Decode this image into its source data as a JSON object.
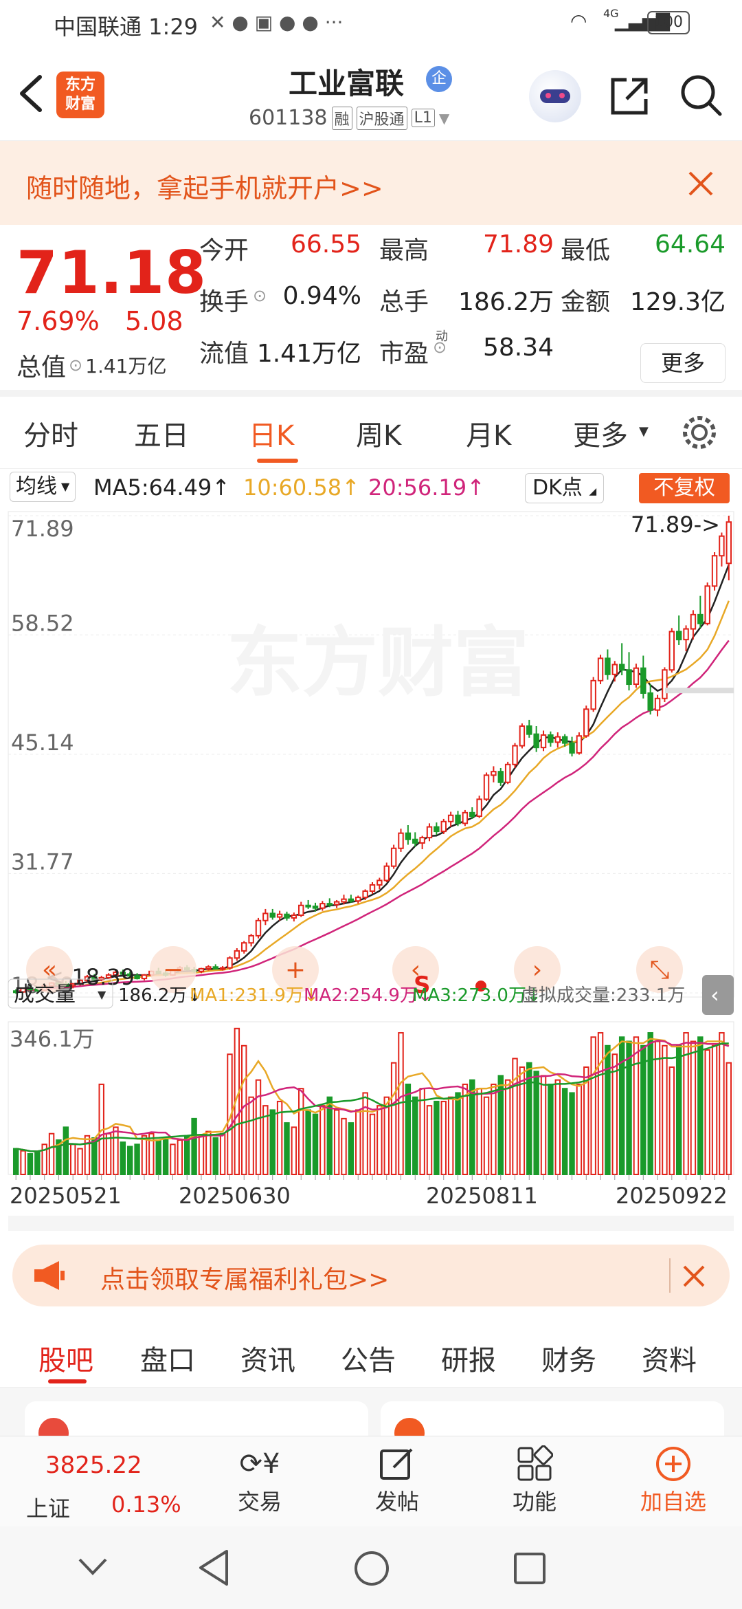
{
  "status_bar": {
    "carrier_time": "中国联通 1:29",
    "battery": "100",
    "signal": "4G"
  },
  "header": {
    "logo_text": "东方\n财富",
    "title": "工业富联",
    "title_badge": "企",
    "code": "601138",
    "tags": [
      "融",
      "沪股通",
      "L1"
    ]
  },
  "banner": {
    "text": "随时随地，拿起手机就开户>>"
  },
  "quote": {
    "price": "71.18",
    "change_pct": "7.69%",
    "change": "5.08",
    "total_value_label": "总值",
    "total_value": "1.41万亿",
    "stats": [
      {
        "label": "今开",
        "value": "66.55",
        "color": "#e2231a"
      },
      {
        "label": "最高",
        "value": "71.89",
        "color": "#e2231a"
      },
      {
        "label": "最低",
        "value": "64.64",
        "color": "#1a9a2a"
      },
      {
        "label": "换手",
        "value": "0.94%",
        "color": "#222222"
      },
      {
        "label": "总手",
        "value": "186.2万",
        "color": "#222222"
      },
      {
        "label": "金额",
        "value": "129.3亿",
        "color": "#222222"
      },
      {
        "label": "流值",
        "value": "1.41万亿",
        "color": "#222222"
      },
      {
        "label": "市盈",
        "value": "58.34",
        "color": "#222222",
        "sup": "动"
      }
    ],
    "more_button": "更多"
  },
  "period_tabs": [
    "分时",
    "五日",
    "日K",
    "周K",
    "月K",
    "更多"
  ],
  "active_period": "日K",
  "chart_header": {
    "indicator_select": "均线",
    "ma5": "MA5:64.49↑",
    "ma10": "10:60.58↑",
    "ma20": "20:56.19↑",
    "dk_select": "DK点",
    "restore_button": "不复权"
  },
  "volume_header": {
    "select": "成交量",
    "vol": "186.2万↓",
    "ma1": "MA1:231.9万↓",
    "ma2": "MA2:254.9万↓",
    "ma3": "MA3:273.0万↓",
    "virtual": "虚拟成交量:233.1万"
  },
  "chart_data": {
    "type": "candlestick",
    "y_ticks": [
      "71.89",
      "58.52",
      "45.14",
      "31.77",
      "18.39"
    ],
    "ylim": [
      18.39,
      71.89
    ],
    "high_label": "71.89->",
    "low_label": "<-18.39",
    "volume_max_label": "346.1万",
    "x_labels": [
      "20250521",
      "20250630",
      "20250811",
      "20250922"
    ],
    "watermark": "东方财富",
    "marker": "S",
    "candles": [
      [
        18.6,
        18.8,
        18.3,
        18.5
      ],
      [
        18.5,
        19.0,
        18.4,
        18.9
      ],
      [
        18.9,
        19.2,
        18.7,
        18.8
      ],
      [
        18.8,
        19.0,
        18.5,
        18.7
      ],
      [
        18.7,
        19.3,
        18.6,
        19.2
      ],
      [
        19.2,
        19.6,
        19.0,
        19.5
      ],
      [
        19.5,
        19.8,
        19.3,
        19.4
      ],
      [
        19.4,
        19.7,
        19.1,
        19.2
      ],
      [
        19.2,
        19.5,
        18.9,
        19.4
      ],
      [
        19.4,
        19.9,
        19.2,
        19.8
      ],
      [
        19.8,
        20.4,
        19.6,
        20.2
      ],
      [
        20.2,
        20.5,
        19.8,
        19.9
      ],
      [
        19.9,
        20.3,
        19.7,
        20.1
      ],
      [
        20.1,
        20.6,
        19.9,
        20.4
      ],
      [
        20.4,
        20.9,
        20.2,
        20.7
      ],
      [
        20.7,
        21.0,
        20.3,
        20.5
      ],
      [
        20.5,
        20.8,
        20.1,
        20.3
      ],
      [
        20.3,
        20.6,
        19.9,
        20.0
      ],
      [
        20.0,
        20.5,
        19.8,
        20.4
      ],
      [
        20.4,
        20.9,
        20.2,
        20.8
      ],
      [
        20.8,
        21.2,
        20.5,
        20.6
      ],
      [
        20.6,
        20.9,
        20.2,
        20.4
      ],
      [
        20.4,
        21.0,
        20.3,
        20.9
      ],
      [
        20.9,
        21.4,
        20.7,
        21.2
      ],
      [
        21.2,
        21.5,
        20.9,
        21.0
      ],
      [
        21.0,
        21.3,
        20.6,
        20.8
      ],
      [
        20.8,
        21.2,
        20.6,
        21.1
      ],
      [
        21.1,
        21.5,
        20.9,
        21.3
      ],
      [
        21.3,
        21.6,
        21.0,
        21.1
      ],
      [
        21.1,
        21.4,
        20.9,
        21.2
      ],
      [
        21.2,
        22.5,
        21.0,
        22.3
      ],
      [
        22.3,
        23.4,
        22.0,
        23.1
      ],
      [
        23.1,
        24.2,
        22.8,
        24.0
      ],
      [
        24.0,
        25.0,
        23.6,
        24.8
      ],
      [
        24.8,
        26.8,
        24.5,
        26.5
      ],
      [
        26.5,
        27.8,
        26.0,
        27.3
      ],
      [
        27.3,
        27.8,
        26.6,
        26.9
      ],
      [
        26.9,
        27.6,
        26.5,
        27.2
      ],
      [
        27.2,
        27.5,
        26.5,
        26.8
      ],
      [
        26.8,
        27.4,
        26.4,
        27.1
      ],
      [
        27.1,
        28.6,
        26.9,
        28.2
      ],
      [
        28.2,
        28.8,
        27.8,
        28.1
      ],
      [
        28.1,
        28.5,
        27.5,
        27.9
      ],
      [
        27.9,
        28.7,
        27.6,
        28.4
      ],
      [
        28.4,
        29.0,
        28.0,
        28.3
      ],
      [
        28.3,
        28.8,
        27.9,
        28.6
      ],
      [
        28.6,
        29.4,
        28.3,
        28.9
      ],
      [
        28.9,
        29.4,
        28.5,
        28.7
      ],
      [
        28.7,
        29.3,
        28.4,
        29.1
      ],
      [
        29.1,
        30.0,
        28.8,
        29.8
      ],
      [
        29.8,
        30.8,
        29.5,
        30.5
      ],
      [
        30.5,
        31.3,
        30.0,
        31.0
      ],
      [
        31.0,
        33.0,
        30.8,
        32.6
      ],
      [
        32.6,
        35.0,
        32.3,
        34.6
      ],
      [
        34.6,
        36.8,
        34.2,
        36.3
      ],
      [
        36.3,
        37.2,
        35.0,
        35.6
      ],
      [
        35.6,
        36.4,
        34.8,
        35.2
      ],
      [
        35.2,
        36.0,
        34.5,
        35.8
      ],
      [
        35.8,
        37.4,
        35.4,
        37.0
      ],
      [
        37.0,
        37.5,
        36.1,
        36.5
      ],
      [
        36.5,
        37.9,
        36.2,
        37.6
      ],
      [
        37.6,
        38.7,
        37.0,
        38.3
      ],
      [
        38.3,
        38.8,
        37.1,
        37.4
      ],
      [
        37.4,
        38.9,
        37.1,
        38.6
      ],
      [
        38.6,
        39.2,
        37.9,
        38.2
      ],
      [
        38.2,
        40.5,
        38.0,
        40.1
      ],
      [
        40.1,
        43.1,
        39.9,
        42.8
      ],
      [
        42.8,
        43.8,
        42.0,
        43.2
      ],
      [
        43.2,
        43.6,
        41.6,
        42.0
      ],
      [
        42.0,
        44.3,
        41.8,
        44.0
      ],
      [
        44.0,
        46.4,
        43.6,
        46.1
      ],
      [
        46.1,
        48.6,
        45.8,
        48.3
      ],
      [
        48.3,
        49.0,
        47.0,
        47.4
      ],
      [
        47.4,
        48.3,
        45.4,
        45.9
      ],
      [
        45.9,
        47.8,
        45.5,
        47.3
      ],
      [
        47.3,
        47.7,
        46.0,
        46.5
      ],
      [
        46.5,
        47.6,
        45.9,
        47.1
      ],
      [
        47.1,
        47.4,
        46.0,
        46.4
      ],
      [
        46.4,
        47.1,
        44.9,
        45.3
      ],
      [
        45.3,
        47.6,
        45.1,
        47.2
      ],
      [
        47.2,
        50.6,
        47.0,
        50.2
      ],
      [
        50.2,
        53.8,
        49.9,
        53.4
      ],
      [
        53.4,
        56.3,
        53.0,
        55.9
      ],
      [
        55.9,
        56.9,
        53.5,
        54.1
      ],
      [
        54.1,
        55.6,
        53.3,
        55.2
      ],
      [
        55.2,
        57.6,
        54.0,
        54.6
      ],
      [
        54.6,
        56.6,
        52.3,
        53.0
      ],
      [
        53.0,
        55.3,
        52.6,
        54.8
      ],
      [
        54.8,
        56.2,
        51.4,
        52.0
      ],
      [
        52.0,
        53.0,
        49.6,
        50.1
      ],
      [
        50.1,
        51.8,
        49.4,
        51.4
      ],
      [
        51.4,
        54.9,
        51.0,
        54.6
      ],
      [
        54.6,
        59.3,
        54.3,
        58.9
      ],
      [
        58.9,
        60.7,
        57.4,
        58.0
      ],
      [
        58.0,
        59.6,
        56.7,
        59.2
      ],
      [
        59.2,
        61.3,
        58.0,
        60.8
      ],
      [
        60.8,
        62.9,
        59.3,
        59.8
      ],
      [
        59.8,
        64.4,
        59.6,
        64.0
      ],
      [
        64.0,
        67.8,
        63.5,
        67.4
      ],
      [
        67.4,
        70.0,
        66.2,
        69.6
      ],
      [
        66.55,
        71.89,
        64.64,
        71.18
      ]
    ],
    "volumes": [
      60,
      55,
      48,
      52,
      70,
      95,
      80,
      110,
      70,
      60,
      90,
      85,
      210,
      95,
      110,
      75,
      65,
      70,
      90,
      95,
      80,
      85,
      70,
      80,
      90,
      130,
      90,
      100,
      85,
      95,
      280,
      340,
      300,
      180,
      220,
      160,
      150,
      170,
      120,
      110,
      200,
      150,
      140,
      160,
      180,
      150,
      130,
      120,
      150,
      190,
      140,
      160,
      180,
      260,
      330,
      210,
      180,
      200,
      160,
      170,
      170,
      180,
      190,
      210,
      220,
      200,
      180,
      210,
      230,
      220,
      270,
      250,
      260,
      240,
      230,
      210,
      220,
      200,
      190,
      210,
      250,
      320,
      330,
      300,
      280,
      320,
      310,
      320,
      300,
      330,
      310,
      300,
      250,
      300,
      330,
      310,
      320,
      290,
      300,
      330,
      260
    ]
  }
}
